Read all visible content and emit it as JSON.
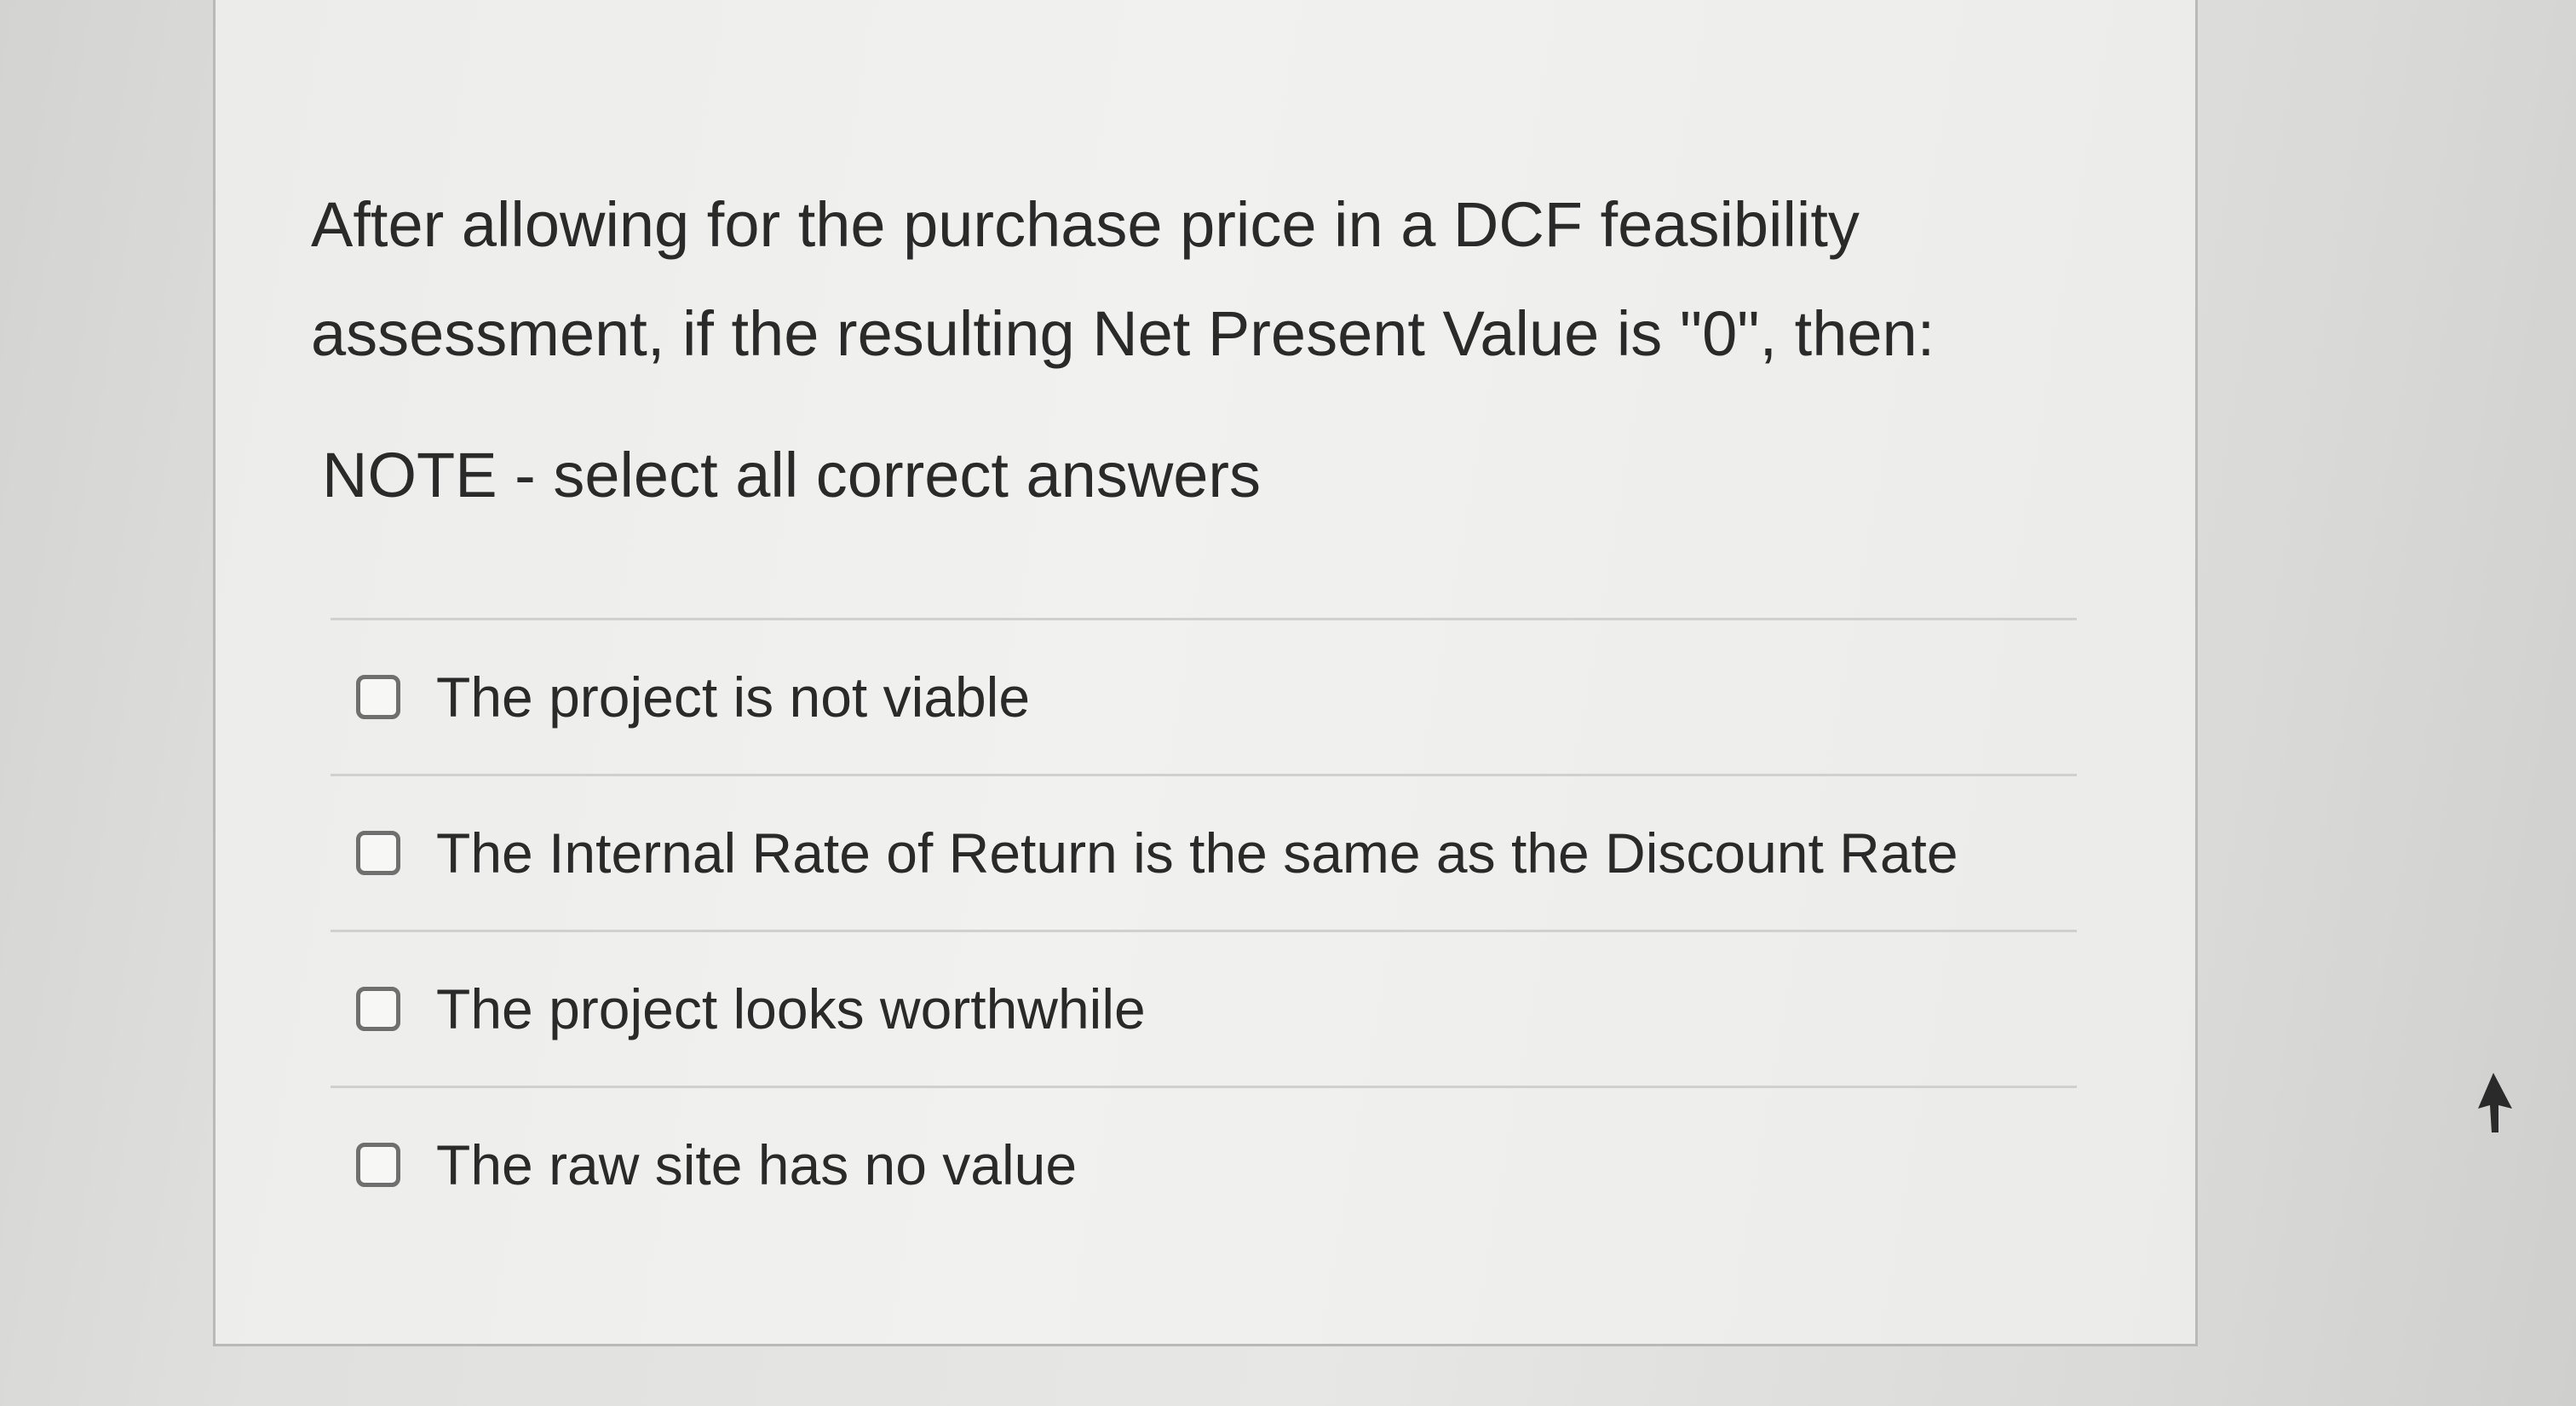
{
  "question": {
    "line1": "After allowing for the purchase price in a DCF feasibility",
    "line2": "assessment, if the resulting Net Present Value is \"0\", then:",
    "note": "NOTE - select all correct answers"
  },
  "options": [
    {
      "label": "The project is not viable",
      "checked": false
    },
    {
      "label": "The Internal Rate of Return is the same as the Discount Rate",
      "checked": false
    },
    {
      "label": "The project looks worthwhile",
      "checked": false
    },
    {
      "label": "The raw site has no value",
      "checked": false
    }
  ],
  "icons": {
    "checkbox": "checkbox-empty-icon",
    "pointer": "mouse-pointer-icon"
  }
}
